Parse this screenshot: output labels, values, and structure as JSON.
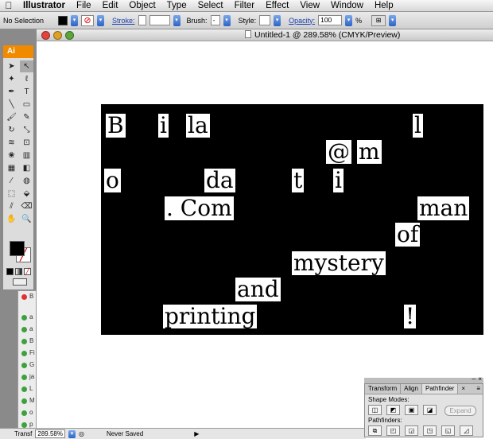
{
  "menubar": {
    "apple": "",
    "items": [
      "Illustrator",
      "File",
      "Edit",
      "Object",
      "Type",
      "Select",
      "Filter",
      "Effect",
      "View",
      "Window",
      "Help"
    ]
  },
  "controlbar": {
    "selection": "No Selection",
    "stroke_label": "Stroke:",
    "brush_label": "Brush:",
    "brush_value": "-",
    "style_label": "Style:",
    "opacity_label": "Opacity:",
    "opacity_value": "100",
    "opacity_unit": "%"
  },
  "document": {
    "title": "Untitled-1 @ 289.58% (CMYK/Preview)"
  },
  "artwork": {
    "tiles": [
      "B",
      "i",
      "la",
      "l",
      "@",
      "m",
      "o",
      "da",
      "t",
      "i",
      ". Com",
      "man",
      "of",
      "mystery",
      "and",
      "printing",
      "!"
    ]
  },
  "toolbox": {
    "logo": "Ai"
  },
  "layers": {
    "items": [
      "B",
      "a",
      "a",
      "B",
      "Fi",
      "G",
      "ja",
      "L",
      "M",
      "o",
      "p"
    ]
  },
  "statusbar": {
    "left_label": "Transf",
    "zoom": "289.58%",
    "status": "Never Saved"
  },
  "pathfinder": {
    "tabs": [
      "Transform",
      "Align",
      "Pathfinder"
    ],
    "close": "×",
    "shape_modes_label": "Shape Modes:",
    "pathfinders_label": "Pathfinders:",
    "expand_label": "Expand"
  },
  "colors": {
    "accent": "#f08a00",
    "link": "#1a3fb0",
    "layer_dot": "#3da23d"
  }
}
